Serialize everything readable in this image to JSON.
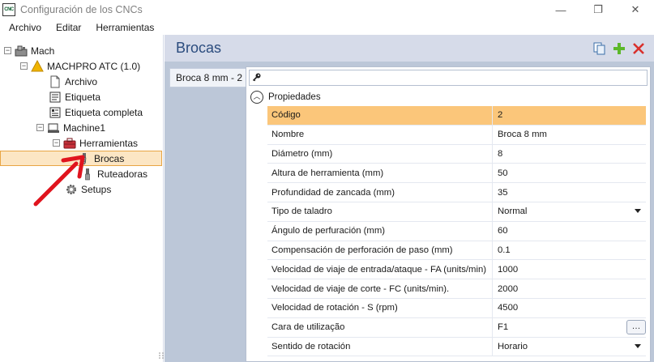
{
  "window": {
    "app_icon_text": "CNC",
    "title": "Configuración de los CNCs",
    "minimize": "—",
    "restore": "❐",
    "close": "✕"
  },
  "menu": [
    "Archivo",
    "Editar",
    "Herramientas"
  ],
  "tree": {
    "root": "Mach",
    "machine": "MACHPRO ATC (1.0)",
    "archivo": "Archivo",
    "etiqueta": "Etiqueta",
    "etiqueta_completa": "Etiqueta completa",
    "machine1": "Machine1",
    "herramientas": "Herramientas",
    "brocas": "Brocas",
    "ruteadoras": "Ruteadoras",
    "setups": "Setups"
  },
  "main": {
    "title": "Brocas",
    "tab_label": "Broca 8 mm - 2",
    "section_label": "Propiedades",
    "ellipsis": "…"
  },
  "properties": [
    {
      "name": "Código",
      "value": "2"
    },
    {
      "name": "Nombre",
      "value": "Broca 8 mm"
    },
    {
      "name": "Diámetro (mm)",
      "value": "8"
    },
    {
      "name": "Altura de herramienta (mm)",
      "value": "50"
    },
    {
      "name": "Profundidad de zancada (mm)",
      "value": "35"
    },
    {
      "name": "Tipo de taladro",
      "value": "Normal"
    },
    {
      "name": "Ángulo de perfuración (mm)",
      "value": "60"
    },
    {
      "name": "Compensación de perforación de paso (mm)",
      "value": "0.1"
    },
    {
      "name": "Velocidad de viaje de entrada/ataque - FA (units/min)",
      "value": "1000"
    },
    {
      "name": "Velocidad de viaje de corte - FC (units/min).",
      "value": "2000"
    },
    {
      "name": "Velocidad de rotación - S (rpm)",
      "value": "4500"
    },
    {
      "name": "Cara de utilização",
      "value": "F1"
    },
    {
      "name": "Sentido de rotación",
      "value": "Horario"
    }
  ],
  "colors": {
    "selection_row": "#fbc67a",
    "tree_selection": "#fce6c4",
    "header_text": "#2b4c7e",
    "annotation_arrow": "#e0141e",
    "add_icon": "#5cb82a",
    "delete_icon": "#d9302c"
  }
}
